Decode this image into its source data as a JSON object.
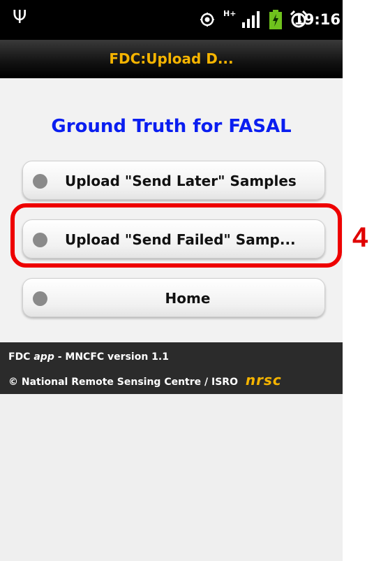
{
  "status_bar": {
    "usb_icon": "usb-icon",
    "gps_icon": "gps-icon",
    "network_type": "H+",
    "signal_icon": "signal-icon",
    "battery_icon": "battery-charging-icon",
    "alarm_icon": "alarm-icon",
    "time": "19:16"
  },
  "title_bar": {
    "title": "FDC:Upload D..."
  },
  "main": {
    "heading": "Ground Truth for FASAL",
    "buttons": [
      {
        "label": "Upload \"Send Later\" Samples"
      },
      {
        "label": "Upload \"Send Failed\" Samp..."
      },
      {
        "label": "Home"
      }
    ]
  },
  "footer": {
    "line1_prefix": "FDC",
    "line1_app": "app",
    "line1_suffix": "- MNCFC version 1.1",
    "line2": "© National Remote Sensing Centre / ISRO",
    "logo": "nrsc"
  },
  "annotation": {
    "step_number": "4"
  },
  "colors": {
    "heading": "#0a1ef0",
    "title": "#f5b400",
    "highlight": "#ee0000"
  }
}
